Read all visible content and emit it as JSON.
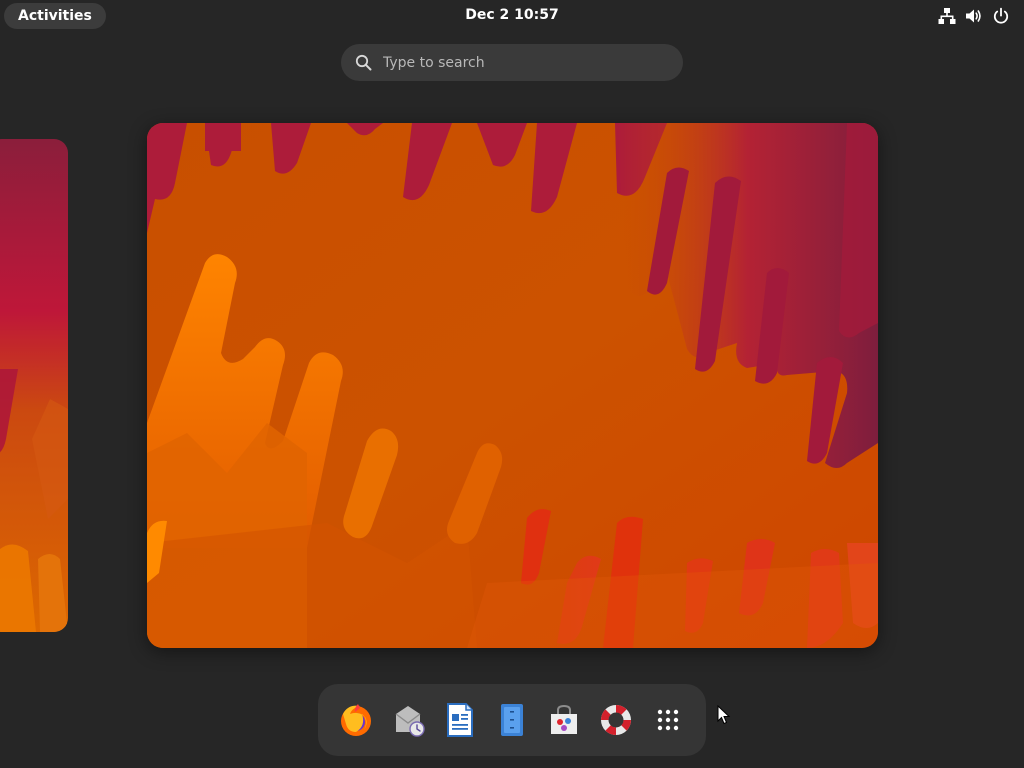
{
  "topbar": {
    "activities_label": "Activities",
    "clock": "Dec 2  10:57",
    "tray_icons": [
      "network-icon",
      "volume-icon",
      "power-icon"
    ]
  },
  "search": {
    "placeholder": "Type to search",
    "value": ""
  },
  "dash": {
    "apps": [
      {
        "name": "firefox",
        "icon": "firefox-icon"
      },
      {
        "name": "evolution",
        "icon": "mail-icon"
      },
      {
        "name": "libreoffice-writer",
        "icon": "writer-icon"
      },
      {
        "name": "text-editor",
        "icon": "text-editor-icon"
      },
      {
        "name": "software",
        "icon": "software-icon"
      },
      {
        "name": "help",
        "icon": "help-icon"
      },
      {
        "name": "show-apps",
        "icon": "app-grid-icon"
      }
    ]
  },
  "colors": {
    "panel_bg": "#262626",
    "search_bg": "#3a3a3a",
    "dash_bg": "#353535",
    "wallpaper_orange": "#cc5200",
    "wallpaper_crimson": "#a5163a",
    "wallpaper_bright": "#ff7f00"
  }
}
